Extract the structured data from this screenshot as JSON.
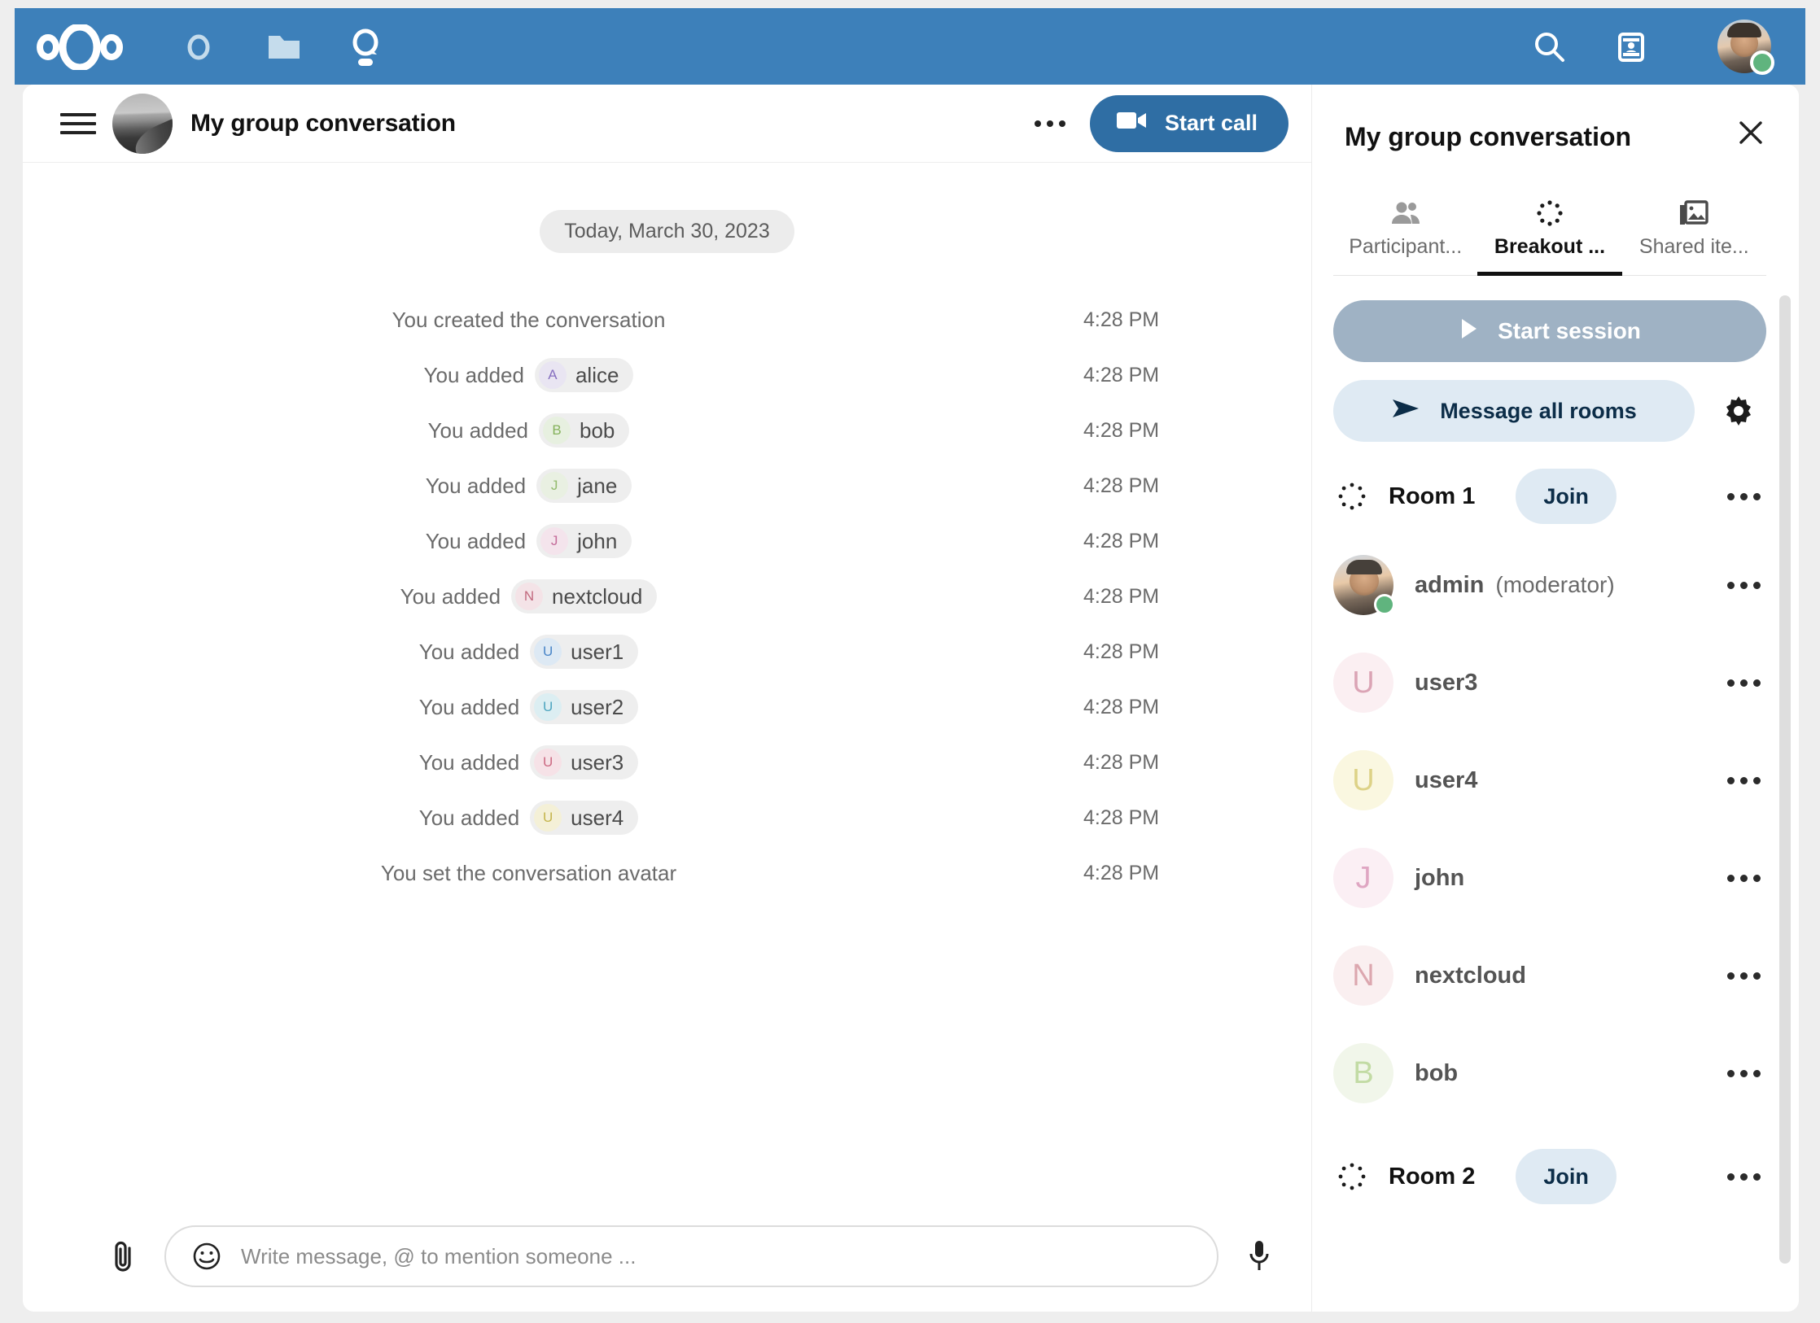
{
  "app": {
    "brand": "nextcloud",
    "nav": [
      {
        "name": "dashboard",
        "label": "Dashboard"
      },
      {
        "name": "files",
        "label": "Files"
      },
      {
        "name": "talk",
        "label": "Talk"
      }
    ],
    "search_label": "Search",
    "contacts_label": "Contacts",
    "user_status": "online",
    "status_color": "#60b47e",
    "accent_color": "#3d80ba"
  },
  "chat": {
    "title": "My group conversation",
    "menu_label": "Conversation actions",
    "start_call_label": "Start call",
    "date_separator": "Today, March 30, 2023",
    "messages": [
      {
        "text": "You created the conversation",
        "mention": null,
        "time": "4:28 PM"
      },
      {
        "text": "You added",
        "mention": {
          "name": "alice",
          "initial": "A",
          "bg": "#e9e5f2",
          "fg": "#8770c0"
        },
        "time": "4:28 PM"
      },
      {
        "text": "You added",
        "mention": {
          "name": "bob",
          "initial": "B",
          "bg": "#e7f0e0",
          "fg": "#85b25c"
        },
        "time": "4:28 PM"
      },
      {
        "text": "You added",
        "mention": {
          "name": "jane",
          "initial": "J",
          "bg": "#e9f0e2",
          "fg": "#93bb6e"
        },
        "time": "4:28 PM"
      },
      {
        "text": "You added",
        "mention": {
          "name": "john",
          "initial": "J",
          "bg": "#f4e4ec",
          "fg": "#c46b99"
        },
        "time": "4:28 PM"
      },
      {
        "text": "You added",
        "mention": {
          "name": "nextcloud",
          "initial": "N",
          "bg": "#f4e3e7",
          "fg": "#c2697e"
        },
        "time": "4:28 PM"
      },
      {
        "text": "You added",
        "mention": {
          "name": "user1",
          "initial": "U",
          "bg": "#dde9f4",
          "fg": "#4a86c8"
        },
        "time": "4:28 PM"
      },
      {
        "text": "You added",
        "mention": {
          "name": "user2",
          "initial": "U",
          "bg": "#dceef2",
          "fg": "#4fa6c0"
        },
        "time": "4:28 PM"
      },
      {
        "text": "You added",
        "mention": {
          "name": "user3",
          "initial": "U",
          "bg": "#f6e2e7",
          "fg": "#cc6a83"
        },
        "time": "4:28 PM"
      },
      {
        "text": "You added",
        "mention": {
          "name": "user4",
          "initial": "U",
          "bg": "#f4f0d7",
          "fg": "#c5b54c"
        },
        "time": "4:28 PM"
      },
      {
        "text": "You set the conversation avatar",
        "mention": null,
        "time": "4:28 PM"
      }
    ],
    "composer": {
      "attach_label": "Attach file",
      "emoji_label": "Insert emoji",
      "placeholder": "Write message, @ to mention someone ...",
      "value": "",
      "mic_label": "Record voice message"
    }
  },
  "sidebar": {
    "title": "My group conversation",
    "close_label": "Close sidebar",
    "tabs": [
      {
        "name": "participants",
        "label": "Participant...",
        "icon": "people-icon",
        "active": false
      },
      {
        "name": "breakout-rooms",
        "label": "Breakout ...",
        "icon": "breakout-rooms-icon",
        "active": true
      },
      {
        "name": "shared-items",
        "label": "Shared ite...",
        "icon": "shared-items-icon",
        "active": false
      }
    ],
    "start_session_label": "Start session",
    "message_all_rooms_label": "Message all rooms",
    "settings_label": "Breakout rooms settings",
    "join_label": "Join",
    "more_label": "More actions",
    "rooms": [
      {
        "name": "Room 1",
        "participants": [
          {
            "name": "admin",
            "sub": "(moderator)",
            "type": "photo",
            "status": "online",
            "initial": "",
            "bg": "",
            "fg": ""
          },
          {
            "name": "user3",
            "sub": "",
            "type": "letter",
            "initial": "U",
            "bg": "#fbeff2",
            "fg": "#dba4b5"
          },
          {
            "name": "user4",
            "sub": "",
            "type": "letter",
            "initial": "U",
            "bg": "#faf7e0",
            "fg": "#ddd287"
          },
          {
            "name": "john",
            "sub": "",
            "type": "letter",
            "initial": "J",
            "bg": "#fbeff4",
            "fg": "#dfa6c2"
          },
          {
            "name": "nextcloud",
            "sub": "",
            "type": "letter",
            "initial": "N",
            "bg": "#faeff0",
            "fg": "#dca7af"
          },
          {
            "name": "bob",
            "sub": "",
            "type": "letter",
            "initial": "B",
            "bg": "#f1f6ea",
            "fg": "#c2dba4"
          }
        ]
      },
      {
        "name": "Room 2",
        "participants": []
      }
    ]
  }
}
